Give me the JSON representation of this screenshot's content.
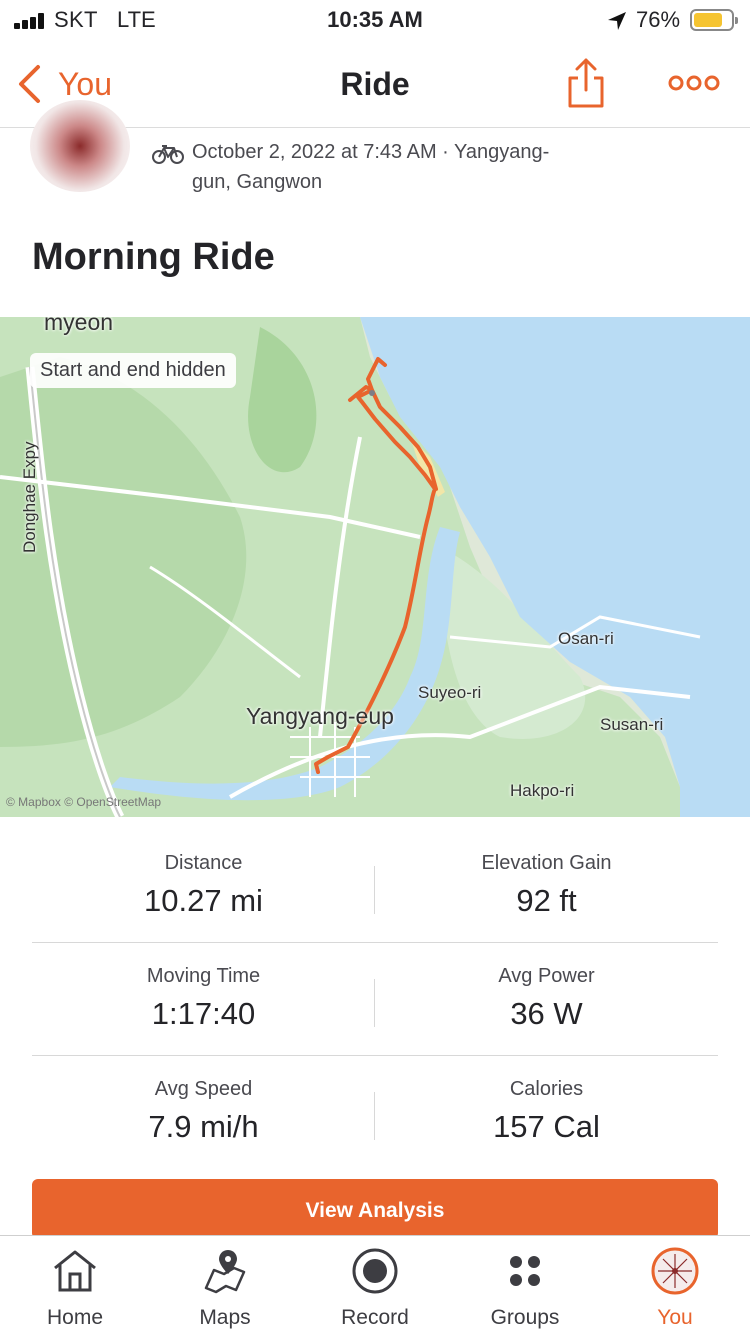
{
  "status_bar": {
    "carrier": "SKT",
    "network": "LTE",
    "time": "10:35 AM",
    "battery_percent_text": "76%",
    "battery_level": 0.76,
    "icons": [
      "signal-icon",
      "location-arrow-icon",
      "battery-icon"
    ]
  },
  "nav": {
    "back_label": "You",
    "title": "Ride",
    "icons": [
      "chevron-left-icon",
      "share-icon",
      "more-icon"
    ]
  },
  "activity": {
    "meta_line1": "October 2, 2022 at 7:43 AM · Yangyang-",
    "meta_line2": "gun, Gangwon",
    "title": "Morning Ride",
    "sport_icon": "bike-icon"
  },
  "map": {
    "privacy_label": "Start and end hidden",
    "labels": {
      "myeon": "myeon",
      "donghae": "Donghae Expy",
      "yangyang": "Yangyang-eup",
      "osan": "Osan-ri",
      "suyeo": "Suyeo-ri",
      "susan": "Susan-ri",
      "hakpo": "Hakpo-ri"
    },
    "attribution": "© Mapbox © OpenStreetMap",
    "route_color": "#e8642d",
    "water_color": "#b9dcf4",
    "land_color": "#c8e6c0"
  },
  "stats": {
    "distance_label": "Distance",
    "distance_value": "10.27 mi",
    "elevation_label": "Elevation Gain",
    "elevation_value": "92 ft",
    "moving_time_label": "Moving Time",
    "moving_time_value": "1:17:40",
    "avg_power_label": "Avg Power",
    "avg_power_value": "36 W",
    "avg_speed_label": "Avg Speed",
    "avg_speed_value": "7.9 mi/h",
    "calories_label": "Calories",
    "calories_value": "157 Cal"
  },
  "actions": {
    "view_analysis": "View Analysis"
  },
  "tabbar": {
    "home": "Home",
    "maps": "Maps",
    "record": "Record",
    "groups": "Groups",
    "you": "You",
    "active": "You"
  },
  "colors": {
    "accent": "#e8642d",
    "text_primary": "#242428",
    "text_secondary": "#4a4a50"
  }
}
